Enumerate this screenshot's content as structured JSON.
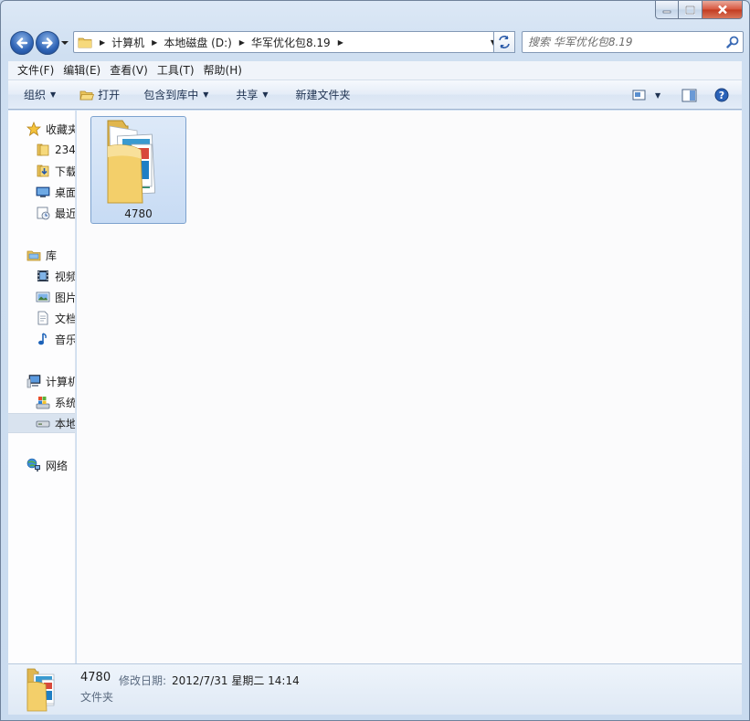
{
  "window": {
    "caption_buttons": [
      "minimize",
      "maximize",
      "close"
    ]
  },
  "address": {
    "crumbs": [
      "计算机",
      "本地磁盘 (D:)",
      "华军优化包8.19"
    ]
  },
  "search": {
    "placeholder": "搜索 华军优化包8.19"
  },
  "menubar": {
    "items": [
      "文件(F)",
      "编辑(E)",
      "查看(V)",
      "工具(T)",
      "帮助(H)"
    ]
  },
  "toolbar": {
    "organize": "组织",
    "open": "打开",
    "include": "包含到库中",
    "share": "共享",
    "new_folder": "新建文件夹",
    "icons": [
      "change-view-icon",
      "preview-pane-icon",
      "help-icon"
    ]
  },
  "navpane": {
    "favorites": {
      "label": "收藏夹",
      "items": [
        "234",
        "下载",
        "桌面",
        "最近"
      ]
    },
    "libraries": {
      "label": "库",
      "items": [
        "视频",
        "图片",
        "文档",
        "音乐"
      ]
    },
    "computer": {
      "label": "计算机",
      "items": [
        "系统",
        "本地"
      ]
    },
    "network": {
      "label": "网络"
    }
  },
  "content": {
    "items": [
      {
        "name": "4780",
        "type": "folder",
        "selected": true
      }
    ]
  },
  "details": {
    "name": "4780",
    "modified_label": "修改日期:",
    "modified_value": "2012/7/31 星期二 14:14",
    "type": "文件夹"
  },
  "colors": {
    "accent": "#2e63b5",
    "selection": "#cfe0f7",
    "folder": "#f3cf6a"
  }
}
